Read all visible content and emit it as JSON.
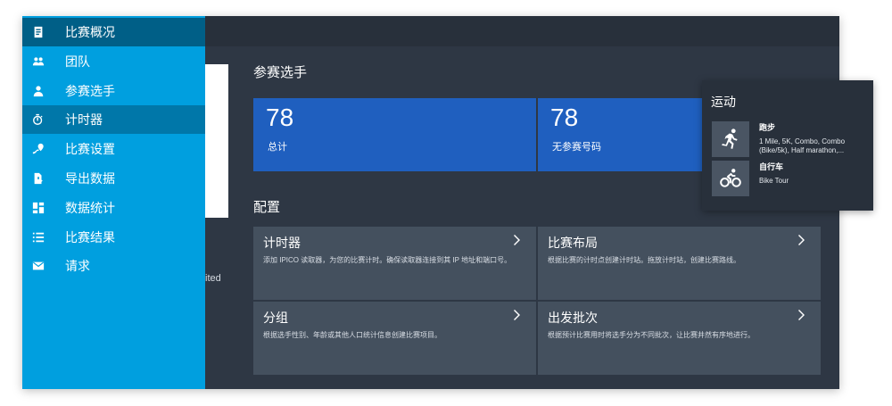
{
  "sidebar": {
    "items": [
      {
        "label": "比赛概况",
        "icon": "document-icon"
      },
      {
        "label": "团队",
        "icon": "people-icon"
      },
      {
        "label": "参赛选手",
        "icon": "person-icon"
      },
      {
        "label": "计时器",
        "icon": "timer-icon"
      },
      {
        "label": "比赛设置",
        "icon": "race-settings-icon"
      },
      {
        "label": "导出数据",
        "icon": "export-icon"
      },
      {
        "label": "数据统计",
        "icon": "dashboard-icon"
      },
      {
        "label": "比赛结果",
        "icon": "list-icon"
      },
      {
        "label": "请求",
        "icon": "mail-icon"
      }
    ]
  },
  "background_fragment": "ited",
  "participants": {
    "title": "参赛选手",
    "stats": [
      {
        "value": "78",
        "caption": "总计"
      },
      {
        "value": "78",
        "caption": "无参赛号码"
      }
    ]
  },
  "config": {
    "title": "配置",
    "cards": [
      {
        "title": "计时器",
        "desc": "添加 IPICO 读取器，为您的比赛计时。确保读取器连接到其 IP 地址和端口号。"
      },
      {
        "title": "比赛布局",
        "desc": "根据比赛的计时点创建计时站。拖放计时站，创建比赛路线。"
      },
      {
        "title": "分组",
        "desc": "根据选手性别、年龄或其他人口统计信息创建比赛项目。"
      },
      {
        "title": "出发批次",
        "desc": "根据预计比赛用时将选手分为不同批次，让比赛井然有序地进行。"
      }
    ]
  },
  "sports": {
    "title": "运动",
    "items": [
      {
        "name": "跑步",
        "desc": "1 Mile, 5K, Combo, Combo (Bike/5k), Half marathon,...",
        "icon": "running-icon"
      },
      {
        "name": "自行车",
        "desc": "Bike Tour",
        "icon": "cycling-icon"
      }
    ]
  },
  "colors": {
    "sidebar": "#009fdf",
    "sidebar_active": "#0077a9",
    "app_background": "#2e3744",
    "stat_tile": "#1f5fbf",
    "card": "#44505e"
  }
}
